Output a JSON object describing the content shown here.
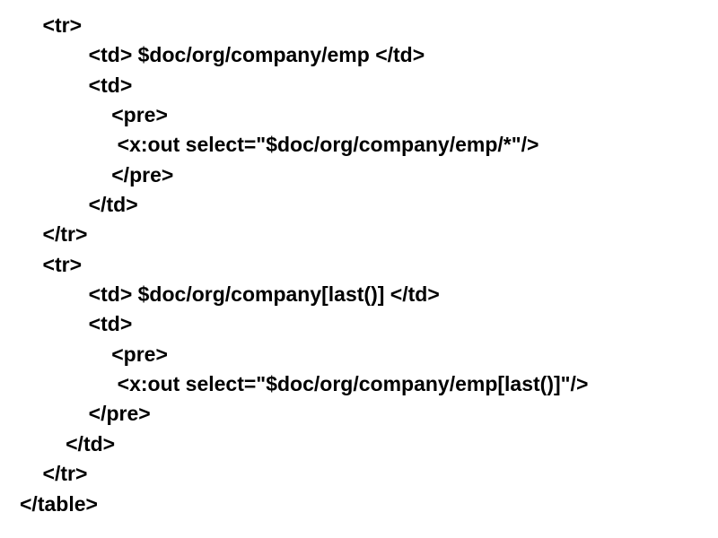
{
  "lines": [
    {
      "indent": 1,
      "text": "<tr>"
    },
    {
      "indent": 3,
      "text": "<td> $doc/org/company/emp </td>"
    },
    {
      "indent": 3,
      "text": "<td>"
    },
    {
      "indent": 4,
      "text": "<pre>"
    },
    {
      "indent": 4,
      "text": " <x:out select=\"$doc/org/company/emp/*\"/>"
    },
    {
      "indent": 4,
      "text": "</pre>"
    },
    {
      "indent": 3,
      "text": "</td>"
    },
    {
      "indent": 1,
      "text": "</tr>"
    },
    {
      "indent": 1,
      "text": "<tr>"
    },
    {
      "indent": 3,
      "text": "<td> $doc/org/company[last()] </td>"
    },
    {
      "indent": 3,
      "text": "<td>"
    },
    {
      "indent": 4,
      "text": "<pre>"
    },
    {
      "indent": 4,
      "text": " <x:out select=\"$doc/org/company/emp[last()]\"/>"
    },
    {
      "indent": 3,
      "text": "</pre>"
    },
    {
      "indent": 2,
      "text": "</td>"
    },
    {
      "indent": 1,
      "text": "</tr>"
    },
    {
      "indent": 0,
      "text": "</table>"
    }
  ],
  "indent_unit": "    "
}
